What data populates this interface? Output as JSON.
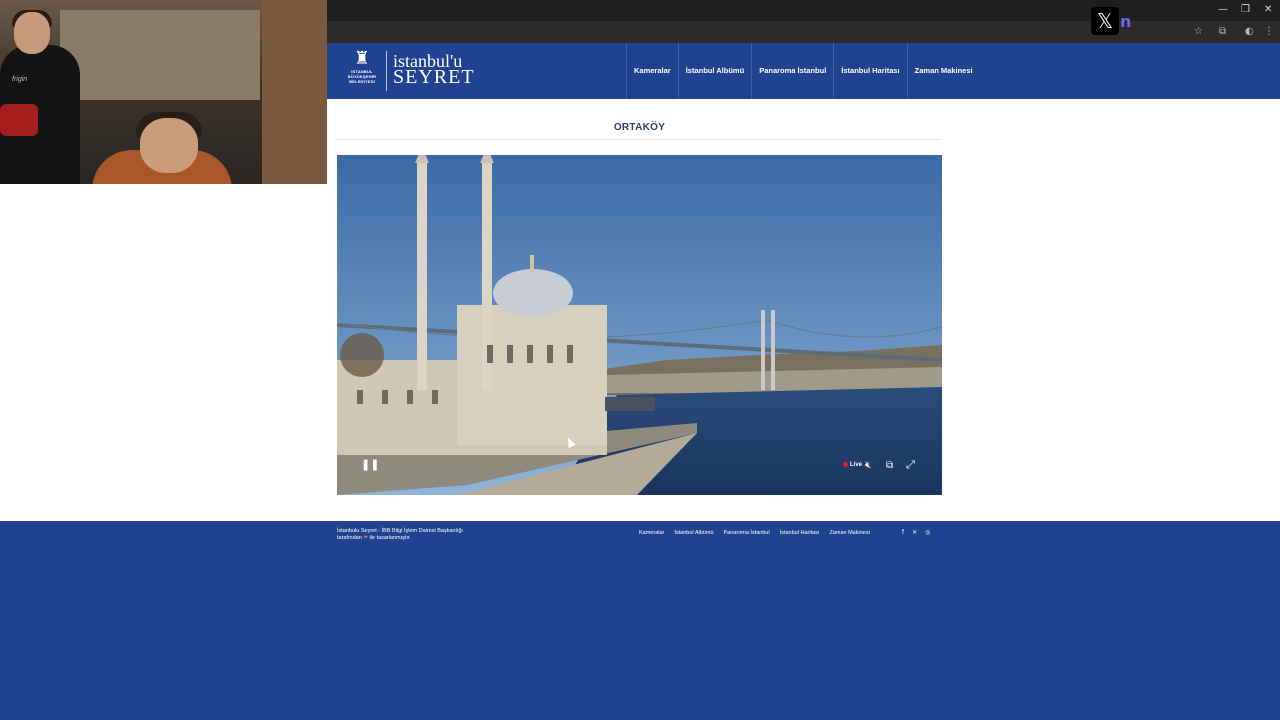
{
  "browser": {
    "minimize": "—",
    "restore": "❐",
    "close": "✕",
    "x_badge": "𝕏",
    "n_badge": "n",
    "icons": [
      "star-icon",
      "extensions-icon",
      "profile-icon",
      "menu-icon"
    ]
  },
  "webcam": {
    "shirt_text": "frigin"
  },
  "site": {
    "logo_line1": "istanbul'u",
    "logo_line2": "SEYRET",
    "emblem_caption1": "İSTANBUL",
    "emblem_caption2": "BÜYÜKŞEHİR",
    "emblem_caption3": "BELEDİYESİ",
    "nav": [
      "Kameralar",
      "İstanbul Albümü",
      "Panaroma İstanbul",
      "İstanbul Haritası",
      "Zaman Makinesi"
    ]
  },
  "main": {
    "title": "ORTAKÖY",
    "video": {
      "live_label": "Live"
    }
  },
  "footer": {
    "credit_line1": "İstanbulu Seyret - İBB Bilgi İşlem Dairesi Başkanlığı",
    "credit_line2_pre": "tarafından",
    "credit_line2_post": "ile tasarlanmıştır.",
    "nav": [
      "Kameralar",
      "İstanbul Albümü",
      "Panaroma İstanbul",
      "İstanbul Haritası",
      "Zaman Makinesi"
    ],
    "social": [
      "facebook-icon",
      "x-icon",
      "instagram-icon"
    ]
  },
  "colors": {
    "brand_blue": "#1f4391",
    "live_red": "#e02020",
    "heart_pink": "#e3547a"
  }
}
